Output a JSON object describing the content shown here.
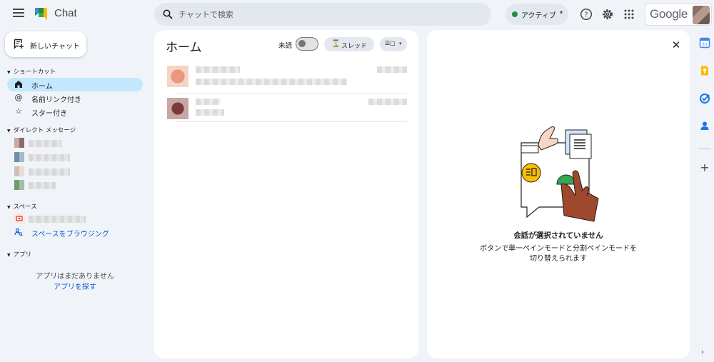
{
  "app": {
    "title": "Chat"
  },
  "search": {
    "placeholder": "チャットで検索"
  },
  "status": {
    "label": "アクティブ",
    "color": "#1e8e3e"
  },
  "topbar": {
    "google_label": "Google"
  },
  "sidebar": {
    "new_chat_label": "新しいチャット",
    "shortcuts_header": "ショートカット",
    "shortcuts": [
      {
        "label": "ホーム",
        "icon": "home-icon",
        "active": true
      },
      {
        "label": "名前リンク付き",
        "icon": "at-sign-icon",
        "active": false
      },
      {
        "label": "スター付き",
        "icon": "star-outline-icon",
        "active": false
      }
    ],
    "dm_header": "ダイレクト メッセージ",
    "spaces_header": "スペース",
    "browse_spaces_label": "スペースをブラウジング",
    "apps_header": "アプリ",
    "apps_empty_text": "アプリはまだありません",
    "apps_find_link": "アプリを探す"
  },
  "home": {
    "title": "ホーム",
    "unread_label": "未読",
    "unread_toggle_on": false,
    "threads_label": "スレッド"
  },
  "detail": {
    "empty_title": "会話が選択されていません",
    "empty_description": "ボタンで単一ペインモードと分割ペインモードを切り替えられます"
  },
  "rail": {
    "icons": [
      "calendar-icon",
      "keep-icon",
      "tasks-icon",
      "contacts-icon"
    ]
  },
  "colors": {
    "accent": "#0b57d0",
    "active_nav": "#c2e7ff",
    "background": "#f0f4f9"
  }
}
